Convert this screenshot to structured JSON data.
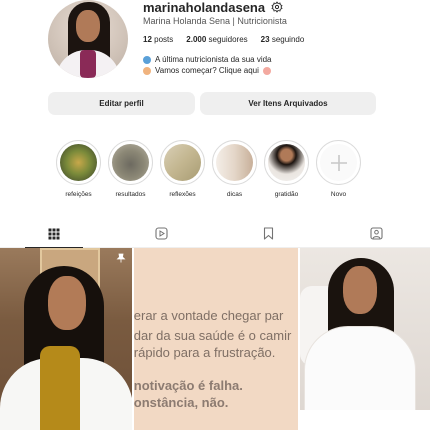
{
  "profile": {
    "username": "marinaholandasena",
    "full_name": "Marina Holanda Sena | Nutricionista",
    "stats": [
      {
        "value": "12",
        "label": "posts"
      },
      {
        "value": "2.000",
        "label": "seguidores"
      },
      {
        "value": "23",
        "label": "seguindo"
      }
    ],
    "bio": [
      "A última nutricionista da sua vida",
      "Vamos começar? Clique aqui"
    ]
  },
  "buttons": {
    "edit_profile": "Editar perfil",
    "archived": "Ver Itens Arquivados"
  },
  "highlights": [
    {
      "label": "refeições",
      "icon": "food-photo"
    },
    {
      "label": "resultados",
      "icon": "results-photo"
    },
    {
      "label": "reflexões",
      "icon": "notebook-photo"
    },
    {
      "label": "dicas",
      "icon": "tips-photo"
    },
    {
      "label": "gratidão",
      "icon": "portrait-photo"
    },
    {
      "label": "Novo",
      "icon": "plus-icon"
    }
  ],
  "tabs": [
    {
      "name": "posts",
      "icon": "grid-icon",
      "active": true
    },
    {
      "name": "reels",
      "icon": "reels-icon",
      "active": false
    },
    {
      "name": "saved",
      "icon": "bookmark-icon",
      "active": false
    },
    {
      "name": "tagged",
      "icon": "tagged-icon",
      "active": false
    }
  ],
  "posts": {
    "quote_lines": [
      "erar a vontade chegar par",
      "dar da sua saúde é o camir",
      "rápido para a frustração.",
      "notivação é falha.",
      "onstância, não."
    ]
  },
  "colors": {
    "button_bg": "#efefef",
    "text": "#262626",
    "quote_bg": "#f2d9c4"
  }
}
